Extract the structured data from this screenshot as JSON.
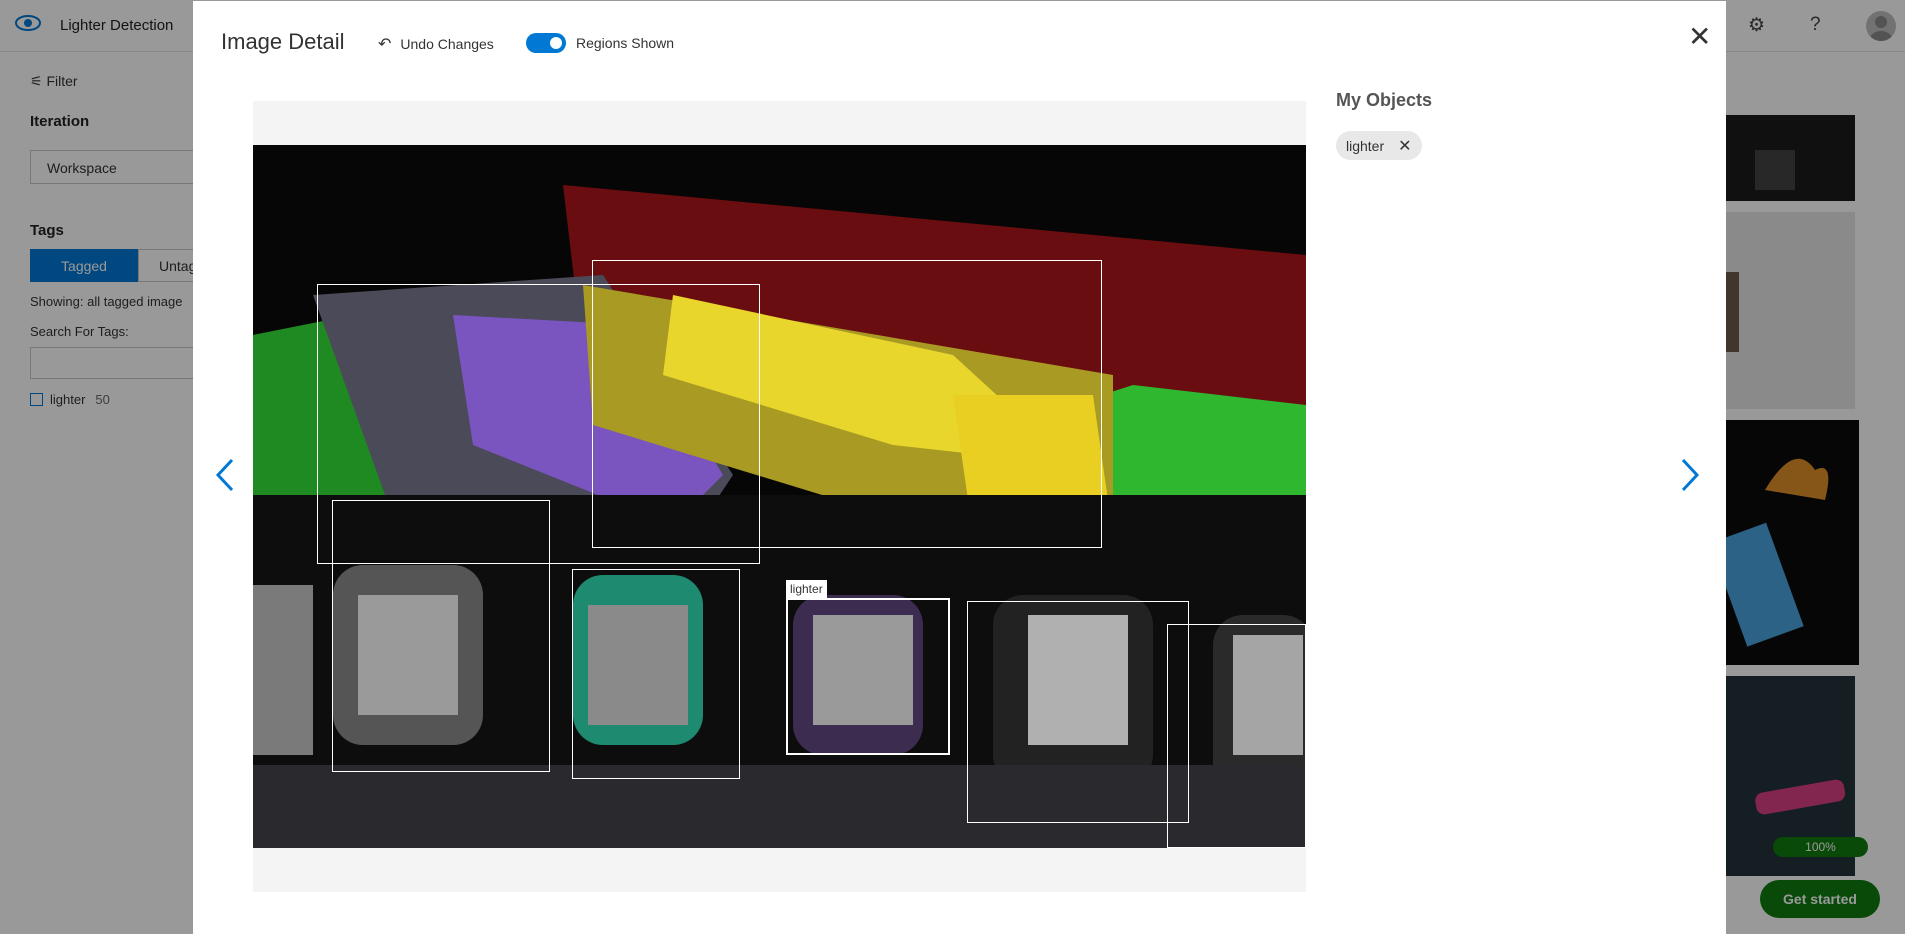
{
  "app": {
    "title": "Lighter Detection"
  },
  "topbar": {
    "settings_icon": "gear-icon",
    "help_icon": "question-icon",
    "help_glyph": "?"
  },
  "sidebar": {
    "filter_label": "Filter",
    "iteration_heading": "Iteration",
    "iteration_value": "Workspace",
    "tags_heading": "Tags",
    "tagged_label": "Tagged",
    "untagged_label": "Untag",
    "showing_text": "Showing: all tagged image",
    "search_label": "Search For Tags:",
    "tag_items": [
      {
        "label": "lighter",
        "count": "50"
      }
    ]
  },
  "progress": {
    "label": "100%",
    "value": 1.0
  },
  "get_started_label": "Get started",
  "modal": {
    "title": "Image Detail",
    "undo_label": "Undo Changes",
    "regions_label": "Regions Shown",
    "regions_on": true,
    "region_tag": "lighter",
    "objects_title": "My Objects",
    "objects": [
      {
        "label": "lighter"
      }
    ]
  },
  "colors": {
    "accent": "#0078d4",
    "green": "#107c10"
  }
}
